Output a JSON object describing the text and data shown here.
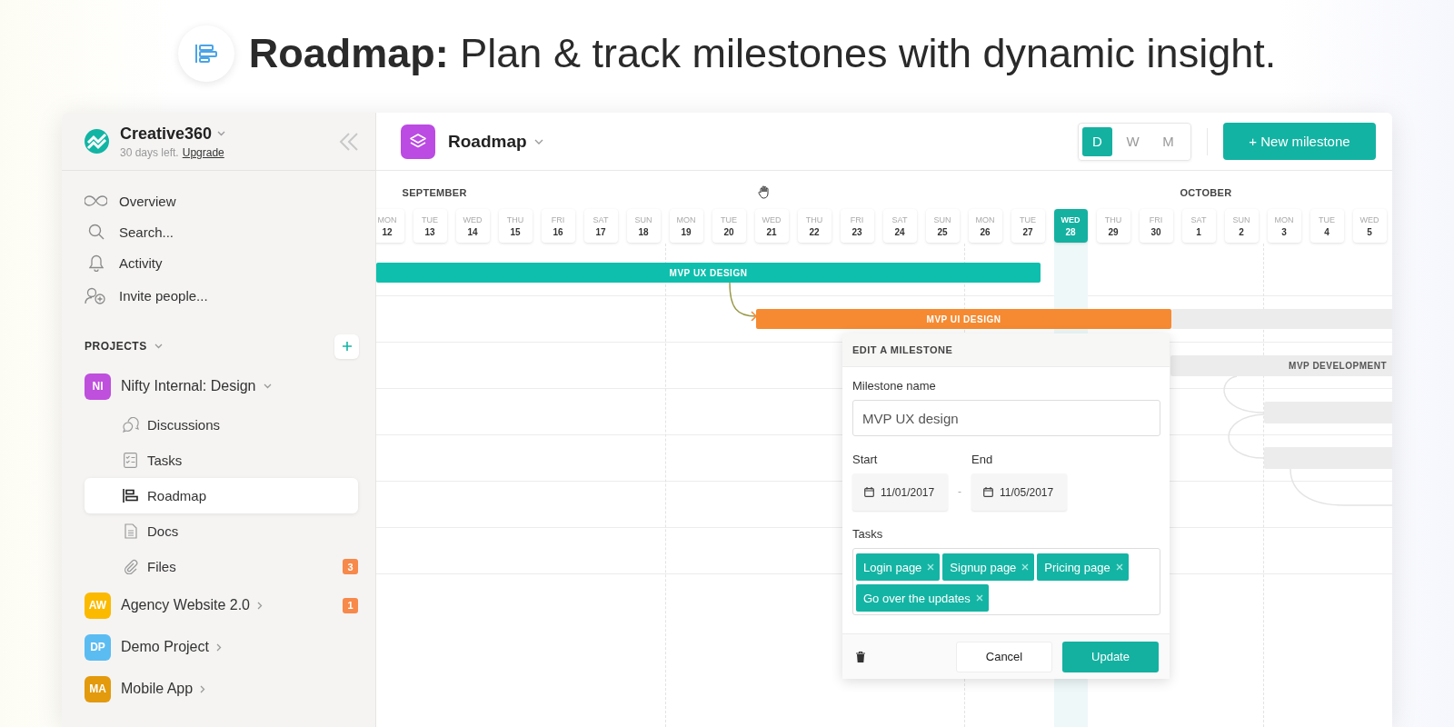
{
  "headline": "**Roadmap:** Plan & track milestones with dynamic insight.",
  "sidebar": {
    "workspace": "Creative360",
    "trial": "30 days left.",
    "upgrade": "Upgrade",
    "nav": [
      {
        "kind": "overview",
        "label": "Overview"
      },
      {
        "kind": "search",
        "label": "Search..."
      },
      {
        "kind": "activity",
        "label": "Activity"
      },
      {
        "kind": "invite",
        "label": "Invite people..."
      }
    ],
    "projects_title": "PROJECTS",
    "projects": [
      {
        "initials": "NI",
        "name": "Nifty Internal: Design",
        "color": "#bf4fdd",
        "expanded": true,
        "children": [
          {
            "kind": "discussions",
            "label": "Discussions",
            "selected": false
          },
          {
            "kind": "tasks",
            "label": "Tasks",
            "selected": false
          },
          {
            "kind": "roadmap",
            "label": "Roadmap",
            "selected": true
          },
          {
            "kind": "docs",
            "label": "Docs",
            "selected": false
          },
          {
            "kind": "files",
            "label": "Files",
            "selected": false,
            "badge": "3"
          }
        ]
      },
      {
        "initials": "AW",
        "name": "Agency Website 2.0",
        "color": "#fbba00",
        "expanded": false,
        "badge": "1"
      },
      {
        "initials": "DP",
        "name": "Demo Project",
        "color": "#5bbcf2",
        "expanded": false
      },
      {
        "initials": "MA",
        "name": "Mobile App",
        "color": "#e39a0c",
        "expanded": false
      }
    ]
  },
  "header": {
    "title": "Roadmap",
    "views": [
      {
        "label": "D",
        "selected": true
      },
      {
        "label": "W",
        "selected": false
      },
      {
        "label": "M",
        "selected": false
      }
    ],
    "new_button": "+ New milestone"
  },
  "timeline": {
    "days": [
      {
        "weekday": "MON",
        "date": "12",
        "selected": false,
        "month": "SEPTEMBER"
      },
      {
        "weekday": "TUE",
        "date": "13",
        "selected": false
      },
      {
        "weekday": "WED",
        "date": "14",
        "selected": false
      },
      {
        "weekday": "THU",
        "date": "15",
        "selected": false
      },
      {
        "weekday": "FRI",
        "date": "16",
        "selected": false
      },
      {
        "weekday": "SAT",
        "date": "17",
        "selected": false
      },
      {
        "weekday": "SUN",
        "date": "18",
        "selected": false
      },
      {
        "weekday": "MON",
        "date": "19",
        "selected": false
      },
      {
        "weekday": "TUE",
        "date": "20",
        "selected": false
      },
      {
        "weekday": "WED",
        "date": "21",
        "selected": false
      },
      {
        "weekday": "THU",
        "date": "22",
        "selected": false
      },
      {
        "weekday": "FRI",
        "date": "23",
        "selected": false
      },
      {
        "weekday": "SAT",
        "date": "24",
        "selected": false
      },
      {
        "weekday": "SUN",
        "date": "25",
        "selected": false
      },
      {
        "weekday": "MON",
        "date": "26",
        "selected": false
      },
      {
        "weekday": "TUE",
        "date": "27",
        "selected": false
      },
      {
        "weekday": "WED",
        "date": "28",
        "selected": true
      },
      {
        "weekday": "THU",
        "date": "29",
        "selected": false
      },
      {
        "weekday": "FRI",
        "date": "30",
        "selected": false
      },
      {
        "weekday": "SAT",
        "date": "1",
        "selected": false,
        "month": "OCTOBER"
      },
      {
        "weekday": "SUN",
        "date": "2",
        "selected": false
      },
      {
        "weekday": "MON",
        "date": "3",
        "selected": false
      },
      {
        "weekday": "TUE",
        "date": "4",
        "selected": false
      },
      {
        "weekday": "WED",
        "date": "5",
        "selected": false
      }
    ],
    "milestones": [
      {
        "label": "MVP UX DESIGN",
        "color": "#0fbfad"
      },
      {
        "label": "MVP UI DESIGN",
        "color": "#f58a32"
      },
      {
        "color": "#ececec"
      },
      {
        "label": "MVP DEVELOPMENT",
        "color": "#ececec"
      },
      {
        "color": "#ececec"
      },
      {
        "color": "#ececec"
      }
    ]
  },
  "editor": {
    "title": "EDIT A MILESTONE",
    "name_label": "Milestone name",
    "name_value": "MVP UX design",
    "start_label": "Start",
    "start_value": "11/01/2017",
    "separator": "-",
    "end_label": "End",
    "end_value": "11/05/2017",
    "tasks_label": "Tasks",
    "tasks": [
      "Login page",
      "Signup page",
      "Pricing page",
      "Go over the updates"
    ],
    "cancel": "Cancel",
    "update": "Update"
  }
}
